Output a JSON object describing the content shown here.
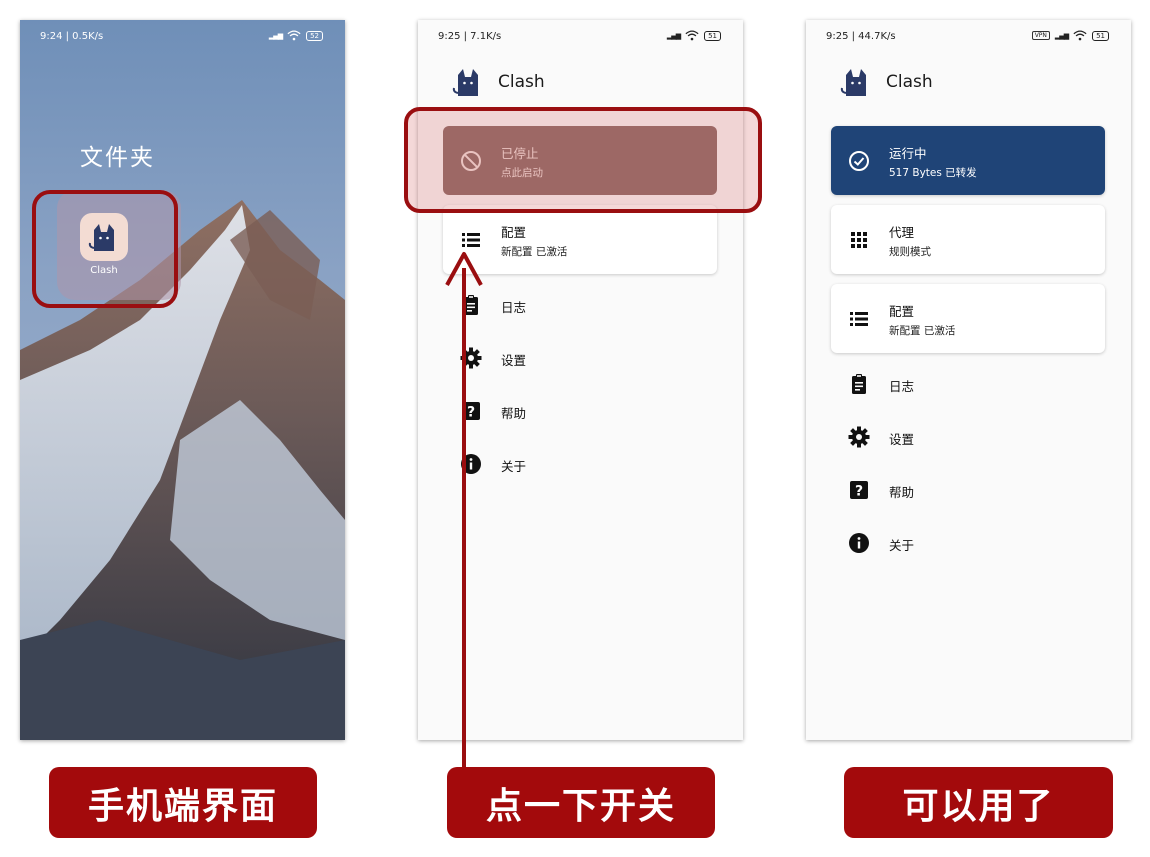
{
  "colors": {
    "caption_bg": "#a30a0c",
    "highlight": "#9a0e10",
    "running_card": "#1f4477",
    "stopped_card": "#8b6a66"
  },
  "screen1": {
    "status": {
      "time": "9:24 | 0.5K/s",
      "battery": "52"
    },
    "folder_title": "文件夹",
    "app_label": "Clash"
  },
  "screen2": {
    "status": {
      "time": "9:25 | 7.1K/s",
      "battery": "51"
    },
    "app_title": "Clash",
    "status_card": {
      "title": "已停止",
      "subtitle": "点此启动",
      "icon": "block-icon"
    },
    "profile_card": {
      "title": "配置",
      "subtitle": "新配置 已激活",
      "icon": "list-icon"
    },
    "menu": [
      {
        "label": "日志",
        "icon": "clipboard-icon"
      },
      {
        "label": "设置",
        "icon": "gear-icon"
      },
      {
        "label": "帮助",
        "icon": "help-icon"
      },
      {
        "label": "关于",
        "icon": "info-icon"
      }
    ]
  },
  "screen3": {
    "status": {
      "time": "9:25 | 44.7K/s",
      "battery": "51",
      "vpn": "VPN"
    },
    "app_title": "Clash",
    "status_card": {
      "title": "运行中",
      "subtitle": "517 Bytes 已转发",
      "icon": "check-circle-icon"
    },
    "proxy_card": {
      "title": "代理",
      "subtitle": "规则模式",
      "icon": "grid-icon"
    },
    "profile_card": {
      "title": "配置",
      "subtitle": "新配置 已激活",
      "icon": "list-icon"
    },
    "menu": [
      {
        "label": "日志",
        "icon": "clipboard-icon"
      },
      {
        "label": "设置",
        "icon": "gear-icon"
      },
      {
        "label": "帮助",
        "icon": "help-icon"
      },
      {
        "label": "关于",
        "icon": "info-icon"
      }
    ]
  },
  "captions": [
    "手机端界面",
    "点一下开关",
    "可以用了"
  ]
}
